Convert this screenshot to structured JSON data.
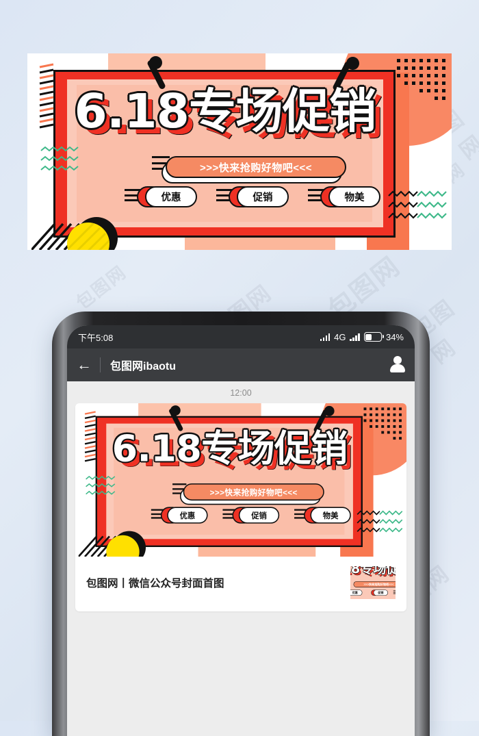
{
  "background": {
    "color_start": "#dce6f4",
    "color_end": "#e8eef7"
  },
  "watermark": {
    "text": "包图网",
    "count": 14
  },
  "banner": {
    "title": "6.18专场促销",
    "subtitle": ">>>快来抢购好物吧<<<",
    "tags": [
      "优惠",
      "促销",
      "物美"
    ],
    "colors": {
      "red": "#ef3124",
      "coral": "#f8774f",
      "salmon": "#f98864",
      "peach": "#fbc9b8",
      "peach_dark": "#f9b49c",
      "yellow": "#ffe000",
      "black": "#111111",
      "green": "#3fb98a",
      "white": "#ffffff"
    },
    "decor": {
      "dash_left": "alternating-orange-black-dashes",
      "zigzag_left": "green-zigzag",
      "zigzag_right": "green-black-zigzag",
      "dots_top_right": "black-square-dot-grid",
      "circle_top_right": "salmon-circle",
      "yellow_circle_bottom_left": "yellow-circle-with-black-circle",
      "diagonal_stripes_bottom_left": "black-diagonal-stripes",
      "pins": "two-black-pushpins"
    }
  },
  "phone": {
    "statusbar": {
      "time": "下午5:08",
      "network": "4G",
      "battery": "34%",
      "signal_icon": "signal-bars-icon",
      "signal_icon_2": "signal-bars-icon",
      "battery_icon": "battery-icon"
    },
    "navbar": {
      "back_icon": "back-arrow-icon",
      "title": "包图网ibaotu",
      "avatar_icon": "person-avatar-icon"
    },
    "chat": {
      "timestamp": "12:00",
      "caption": "包图网丨微信公众号封面首图",
      "thumbnail": "banner-thumbnail"
    }
  }
}
